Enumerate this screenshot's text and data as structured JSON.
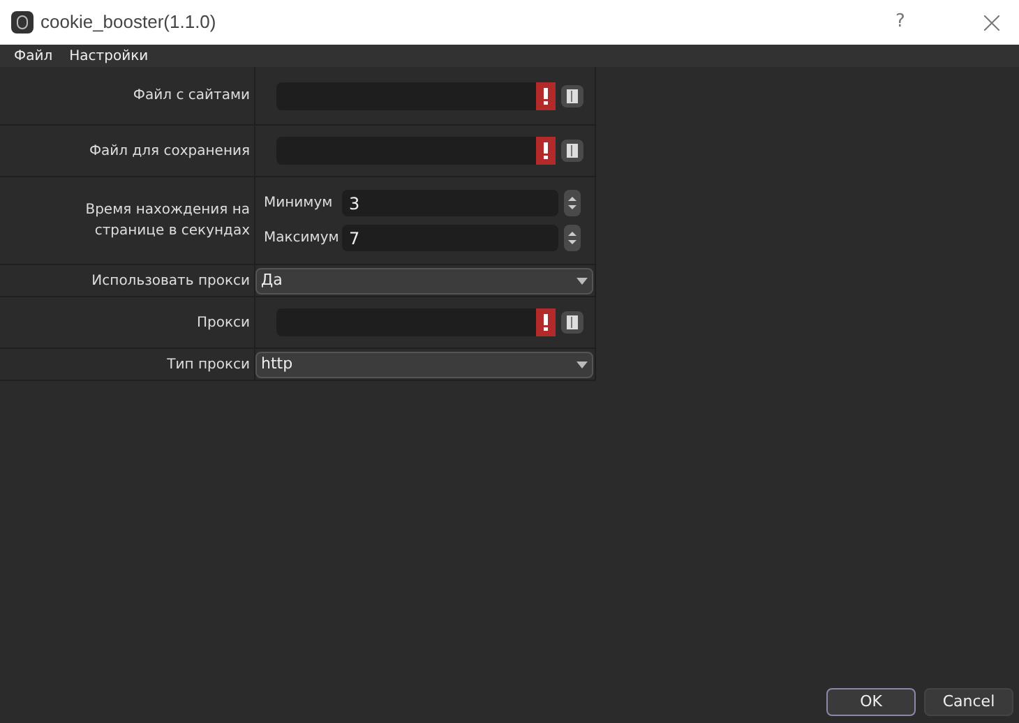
{
  "window": {
    "title": "cookie_booster(1.1.0)",
    "help": "?"
  },
  "menu": [
    "Файл",
    "Настройки"
  ],
  "rows": [
    {
      "kind": "file",
      "label": "Файл с сайтами",
      "error": true
    },
    {
      "kind": "file",
      "label": "Файл для сохранения",
      "error": true
    },
    {
      "kind": "range",
      "label": "Время нахождения на странице в секундах",
      "fields": [
        {
          "label": "Минимум",
          "value": "3"
        },
        {
          "label": "Максимум",
          "value": "7"
        }
      ]
    },
    {
      "kind": "select",
      "label": "Использовать прокси",
      "value": "Да"
    },
    {
      "kind": "file",
      "label": "Прокси",
      "error": true
    },
    {
      "kind": "select",
      "label": "Тип прокси",
      "value": "http"
    }
  ],
  "buttons": [
    {
      "label": "OK",
      "selected": true
    },
    {
      "label": "Cancel",
      "selected": false
    }
  ]
}
